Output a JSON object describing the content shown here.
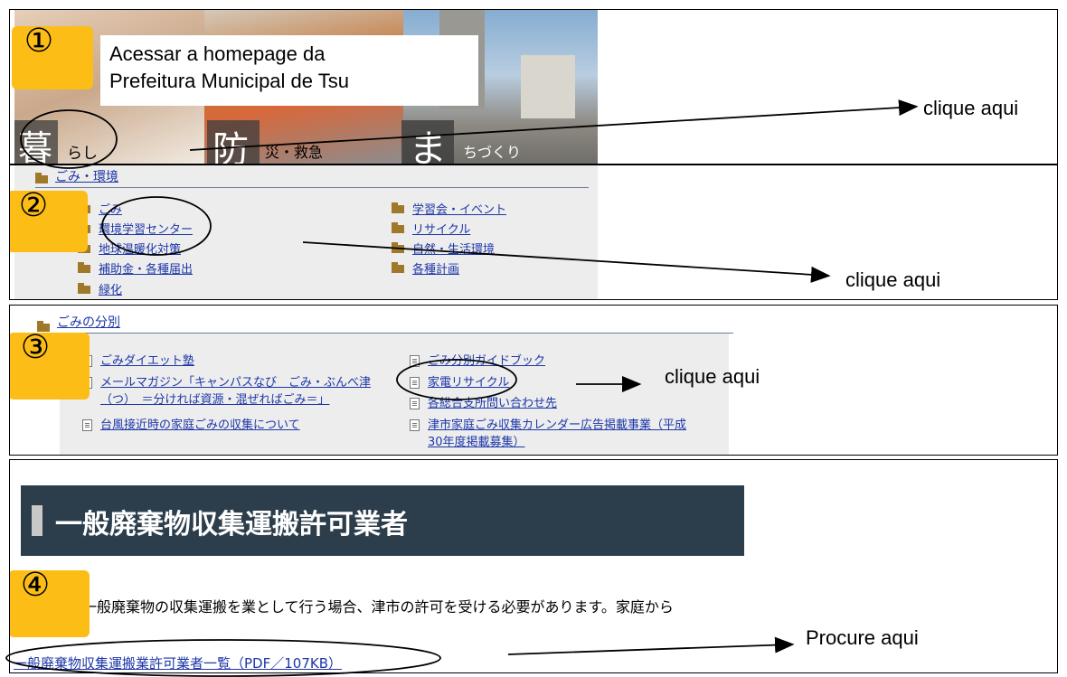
{
  "step1": {
    "number": "①",
    "caption_line1": "Acessar a homepage da",
    "caption_line2": "Prefeitura Municipal de Tsu",
    "tile1_kanji": "暮",
    "tile1_label": "らし",
    "tile2_kanji": "防",
    "tile2_label": "災・救急",
    "tile3_kanji": "ま",
    "tile3_label": "ちづくり",
    "note": "clique aqui"
  },
  "step2": {
    "number": "②",
    "section_title": "ごみ・環境",
    "left_links": [
      "ごみ",
      "環境学習センター",
      "地球温暖化対策",
      "補助金・各種届出",
      "緑化"
    ],
    "right_links": [
      "学習会・イベント",
      "リサイクル",
      "自然・生活環境",
      "各種計画"
    ],
    "note": "clique aqui"
  },
  "step3": {
    "number": "③",
    "section_title": "ごみの分別",
    "left1": "ごみダイエット塾",
    "left2_line1": "メールマガジン「キャンパスなび　ごみ・ぶんべ津",
    "left2_line2": "（つ）　＝分ければ資源・混ぜればごみ＝」",
    "left3": "台風接近時の家庭ごみの収集について",
    "right1": "ごみ分別ガイドブック",
    "right2": "家電リサイクル",
    "right3": "各総合支所問い合わせ先",
    "right4_line1": "津市家庭ごみ収集カレンダー広告掲載事業（平成",
    "right4_line2": "30年度掲載募集）",
    "note": "clique aqui"
  },
  "step4": {
    "number": "④",
    "heading": "一般廃棄物収集運搬許可業者",
    "body": "一般廃棄物の収集運搬を業として行う場合、津市の許可を受ける必要があります。家庭から",
    "link": "一般廃棄物収集運搬業許可業者一覧（PDF／107KB）",
    "note": "Procure aqui"
  },
  "colors": {
    "badge": "#fbbd16",
    "link": "#1d37a8",
    "heading_bg": "#2c3e4c"
  }
}
